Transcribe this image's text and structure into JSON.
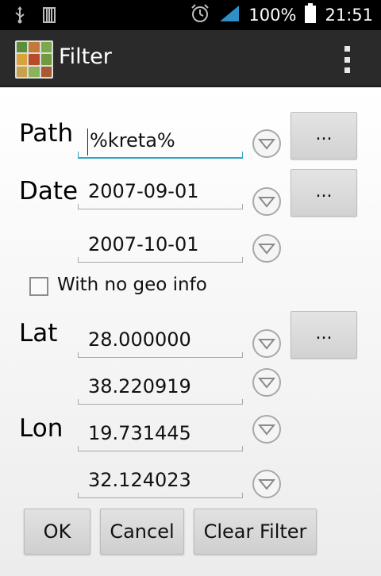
{
  "status_bar": {
    "battery_percent": "100%",
    "time": "21:51",
    "icons": [
      "usb-icon",
      "sdcard-icon",
      "alarm-icon",
      "signal-icon",
      "battery-icon"
    ]
  },
  "action_bar": {
    "title": "Filter",
    "overflow_icon": "overflow-menu-icon"
  },
  "form": {
    "path": {
      "label": "Path",
      "value": "%kreta%",
      "browse_label": "..."
    },
    "date": {
      "label": "Date",
      "from": "2007-09-01",
      "to": "2007-10-01",
      "browse_label": "..."
    },
    "geo": {
      "checkbox_label": "With no geo info",
      "checked": false
    },
    "lat": {
      "label": "Lat",
      "from": "28.000000",
      "to": "38.220919",
      "browse_label": "..."
    },
    "lon": {
      "label": "Lon",
      "from": "19.731445",
      "to": "32.124023"
    }
  },
  "buttons": {
    "ok": "OK",
    "cancel": "Cancel",
    "clear": "Clear Filter"
  },
  "colors": {
    "accent": "#33a3c9",
    "action_bar": "#2a2a2a",
    "status_bar": "#000000"
  }
}
